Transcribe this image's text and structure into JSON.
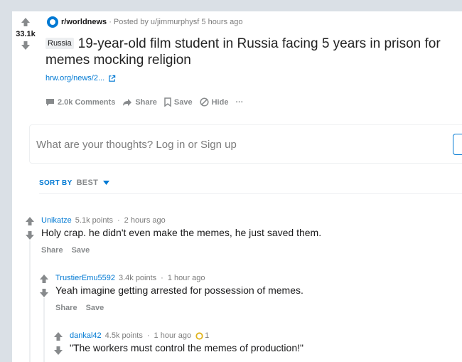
{
  "post": {
    "score": "33.1k",
    "subreddit": "r/worldnews",
    "posted_by": "· Posted by u/jimmurphysf 5 hours ago",
    "flair": "Russia",
    "title": "19-year-old film student in Russia facing 5 years in prison for memes mocking religion",
    "link_text": "hrw.org/news/2...",
    "actions": {
      "comments": "2.0k Comments",
      "share": "Share",
      "save": "Save",
      "hide": "Hide",
      "more": "···"
    }
  },
  "comment_box": {
    "prompt": "What are your thoughts? Log in or Sign up"
  },
  "sort": {
    "label": "SORT BY",
    "value": "BEST"
  },
  "comments": [
    {
      "author": "Unikatze",
      "points": "5.1k points",
      "sep": "·",
      "time": "2 hours ago",
      "body": "Holy crap. he didn't even make the memes, he just saved them.",
      "share": "Share",
      "save": "Save"
    },
    {
      "author": "TrustierEmu5592",
      "points": "3.4k points",
      "sep": "·",
      "time": "1 hour ago",
      "body": "Yeah imagine getting arrested for possession of memes.",
      "share": "Share",
      "save": "Save"
    },
    {
      "author": "dankal42",
      "points": "4.5k points",
      "sep": "·",
      "time": "1 hour ago",
      "award_count": "1",
      "body": "\"The workers must control the memes of production!\""
    }
  ],
  "colors": {
    "accent": "#0079d3",
    "muted": "#878a8c",
    "background": "#dae0e6"
  }
}
